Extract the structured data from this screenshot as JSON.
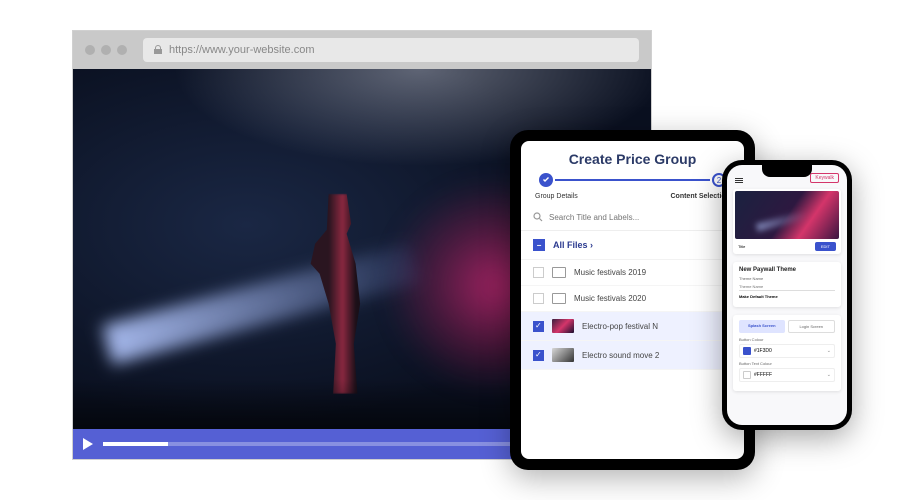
{
  "browser": {
    "url": "https://www.your-website.com"
  },
  "tablet": {
    "title": "Create Price Group",
    "step1": "Group Details",
    "step2": "Content Selection",
    "step2_num": "2",
    "search_placeholder": "Search Title and Labels...",
    "all_files": "All Files ›",
    "rows": [
      {
        "label": "Music festivals 2019"
      },
      {
        "label": "Music festivals 2020"
      },
      {
        "label": "Electro-pop festival N"
      },
      {
        "label": "Electro sound move 2"
      }
    ]
  },
  "phone": {
    "brand": "Keywalk",
    "card_title": "Title",
    "card_btn": "EDIT",
    "section_title": "New Paywall Theme",
    "theme_name_label": "Theme Name",
    "theme_name_placeholder": "Theme Name",
    "make_default": "Make Default Theme",
    "tab1": "Splash Screen",
    "tab2": "Login Screen",
    "button_colour_label": "Button Colour",
    "button_colour_value": "#1F3D0",
    "button_text_colour_label": "Button Text Colour",
    "button_text_colour_value": "#FFFFF"
  },
  "colors": {
    "accent": "#3a52cc",
    "swatch1": "#3a52cc",
    "swatch2": "#ffffff"
  }
}
